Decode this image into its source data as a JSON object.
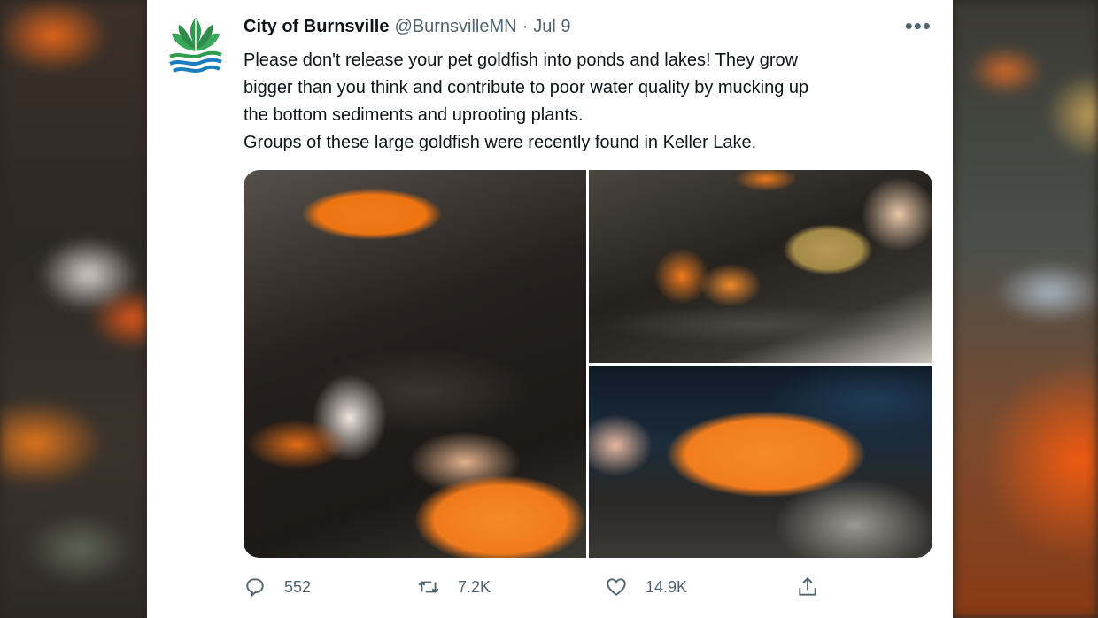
{
  "tweet": {
    "display_name": "City of Burnsville",
    "handle": "@BurnsvilleMN",
    "separator": "·",
    "date": "Jul 9",
    "more_label": "•••",
    "text_lines": [
      "Please don't release your pet goldfish into ponds and lakes! They grow",
      "bigger than you think and contribute to poor water quality by mucking up",
      "the bottom sediments and uprooting plants.",
      "Groups of these large goldfish were recently found in Keller Lake."
    ],
    "photos": [
      {
        "alt": "Hand holding a large goldfish over water"
      },
      {
        "alt": "Several goldfish in a tub of water"
      },
      {
        "alt": "Large goldfish held on a boat"
      }
    ],
    "metrics": {
      "replies": "552",
      "retweets": "7.2K",
      "likes": "14.9K"
    }
  },
  "icons": {
    "avatar": "city-leaf-logo-icon",
    "reply": "reply-icon",
    "retweet": "retweet-icon",
    "like": "heart-icon",
    "share": "share-icon"
  },
  "colors": {
    "name": "#0f1419",
    "secondary": "#536471",
    "logo_green": "#2e8b4a",
    "logo_blue": "#1b7fbf"
  }
}
